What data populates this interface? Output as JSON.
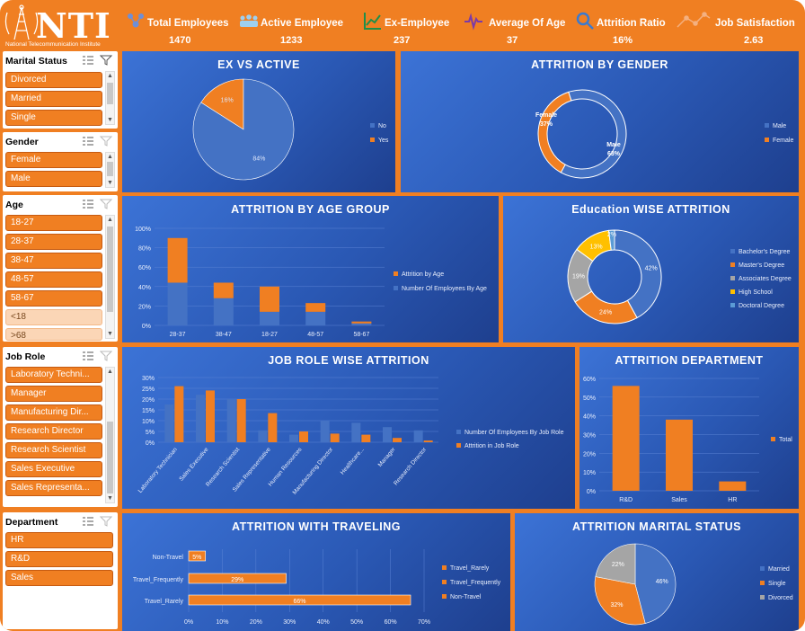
{
  "header": {
    "logo_text": "NTI",
    "logo_subtitle": "National Telecommunication Institute",
    "kpis": [
      {
        "label": "Total Employees",
        "value": "1470",
        "icon": "people-network-icon"
      },
      {
        "label": "Active Employee",
        "value": "1233",
        "icon": "people-group-icon"
      },
      {
        "label": "Ex-Employee",
        "value": "237",
        "icon": "trend-chart-icon"
      },
      {
        "label": "Average Of Age",
        "value": "37",
        "icon": "age-heartbeat-icon"
      },
      {
        "label": "Attrition Ratio",
        "value": "16%",
        "icon": "magnifier-icon"
      },
      {
        "label": "Job Satisfaction",
        "value": "2.63",
        "icon": "line-chart-icon"
      }
    ]
  },
  "slicers": {
    "marital": {
      "title": "Marital Status",
      "items": [
        "Divorced",
        "Married",
        "Single"
      ]
    },
    "gender": {
      "title": "Gender",
      "items": [
        "Female",
        "Male"
      ]
    },
    "age": {
      "title": "Age",
      "items": [
        "18-27",
        "28-37",
        "38-47",
        "48-57",
        "58-67",
        "<18",
        ">68"
      ]
    },
    "jobrole": {
      "title": "Job Role",
      "items": [
        "Laboratory Techni...",
        "Manager",
        "Manufacturing Dir...",
        "Research Director",
        "Research Scientist",
        "Sales Executive",
        "Sales Representa..."
      ]
    },
    "department": {
      "title": "Department",
      "items": [
        "HR",
        "R&D",
        "Sales"
      ]
    }
  },
  "colors": {
    "orange": "#F07F22",
    "blue": "#4472C4",
    "grey": "#A5A5A5",
    "yellow": "#FFC000",
    "lightblue": "#5B9BD5",
    "panel": "#2f5fbf"
  },
  "panels": {
    "ex_active": {
      "title": "EX VS ACTIVE",
      "legend": [
        "No",
        "Yes"
      ],
      "labels": [
        "84%",
        "16%"
      ]
    },
    "gender": {
      "title": "ATTRITION BY GENDER",
      "legend": [
        "Male",
        "Female"
      ],
      "labels": {
        "female": "Female",
        "female_pct": "37%",
        "male": "Male",
        "male_pct": "63%"
      }
    },
    "age": {
      "title": "ATTRITION BY AGE GROUP",
      "legend": [
        "Attrition by Age",
        "Number Of Employees By Age"
      ],
      "yticks": [
        "100%",
        "80%",
        "60%",
        "40%",
        "20%",
        "0%"
      ]
    },
    "education": {
      "title": "Education WISE ATTRITION",
      "legend": [
        "Bachelor's Degree",
        "Master's Degree",
        "Associates Degree",
        "High School",
        "Doctoral Degree"
      ],
      "labels": [
        "42%",
        "24%",
        "19%",
        "13%",
        "2%"
      ]
    },
    "jobrole": {
      "title": "JOB ROLE WISE ATTRITION",
      "legend": [
        "Number Of Employees By Job Role",
        "Attrition in Job Role"
      ],
      "yticks": [
        "30%",
        "25%",
        "20%",
        "15%",
        "10%",
        "5%",
        "0%"
      ]
    },
    "dept": {
      "title": "ATTRITION DEPARTMENT",
      "legend": [
        "Total"
      ],
      "yticks": [
        "60%",
        "50%",
        "40%",
        "30%",
        "20%",
        "10%",
        "0%"
      ]
    },
    "travel": {
      "title": "ATTRITION WITH TRAVELING",
      "legend": [
        "Travel_Rarely",
        "Travel_Frequently",
        "Non-Travel"
      ],
      "xticks": [
        "0%",
        "10%",
        "20%",
        "30%",
        "40%",
        "50%",
        "60%",
        "70%"
      ],
      "labels": [
        "5%",
        "29%",
        "66%"
      ]
    },
    "marital": {
      "title": "ATTRITION MARITAL STATUS",
      "legend": [
        "Married",
        "Single",
        "Divorced"
      ],
      "labels": [
        "46%",
        "32%",
        "22%"
      ]
    }
  },
  "chart_data": [
    {
      "type": "pie",
      "title": "EX VS ACTIVE",
      "categories": [
        "No",
        "Yes"
      ],
      "values": [
        84,
        16
      ]
    },
    {
      "type": "pie",
      "title": "ATTRITION BY GENDER",
      "categories": [
        "Male",
        "Female"
      ],
      "values": [
        63,
        37
      ]
    },
    {
      "type": "bar",
      "title": "ATTRITION BY AGE GROUP",
      "categories": [
        "28-37",
        "38-47",
        "18-27",
        "48-57",
        "58-67"
      ],
      "series": [
        {
          "name": "Number Of Employees By Age",
          "values": [
            44,
            28,
            14,
            14,
            2
          ]
        },
        {
          "name": "Attrition by Age",
          "values": [
            46,
            16,
            26,
            9,
            2
          ]
        }
      ],
      "ylim": [
        0,
        100
      ]
    },
    {
      "type": "pie",
      "title": "Education WISE ATTRITION",
      "categories": [
        "Bachelor's Degree",
        "Master's Degree",
        "Associates Degree",
        "High School",
        "Doctoral Degree"
      ],
      "values": [
        42,
        24,
        19,
        13,
        2
      ]
    },
    {
      "type": "bar",
      "title": "JOB ROLE WISE ATTRITION",
      "categories": [
        "Laboratory Technician",
        "Sales Executive",
        "Research Scientist",
        "Sales Representative",
        "Human Resources",
        "Manufacturing Director",
        "Healthcare...",
        "Manager",
        "Research Director"
      ],
      "series": [
        {
          "name": "Number Of Employees By Job Role",
          "values": [
            17.5,
            22,
            20,
            5.5,
            3.5,
            10,
            9,
            7,
            5.5
          ]
        },
        {
          "name": "Attrition in Job Role",
          "values": [
            26,
            24,
            20,
            13.5,
            5,
            4,
            3.5,
            2,
            0.8
          ]
        }
      ],
      "ylim": [
        0,
        30
      ]
    },
    {
      "type": "bar",
      "title": "ATTRITION DEPARTMENT",
      "categories": [
        "R&D",
        "Sales",
        "HR"
      ],
      "series": [
        {
          "name": "Total",
          "values": [
            56,
            38,
            5
          ]
        }
      ],
      "ylim": [
        0,
        60
      ]
    },
    {
      "type": "bar",
      "title": "ATTRITION WITH TRAVELING",
      "categories": [
        "Non-Travel",
        "Travel_Frequently",
        "Travel_Rarely"
      ],
      "values": [
        5,
        29,
        66
      ],
      "xlim": [
        0,
        70
      ]
    },
    {
      "type": "pie",
      "title": "ATTRITION MARITAL STATUS",
      "categories": [
        "Married",
        "Single",
        "Divorced"
      ],
      "values": [
        46,
        32,
        22
      ]
    }
  ]
}
